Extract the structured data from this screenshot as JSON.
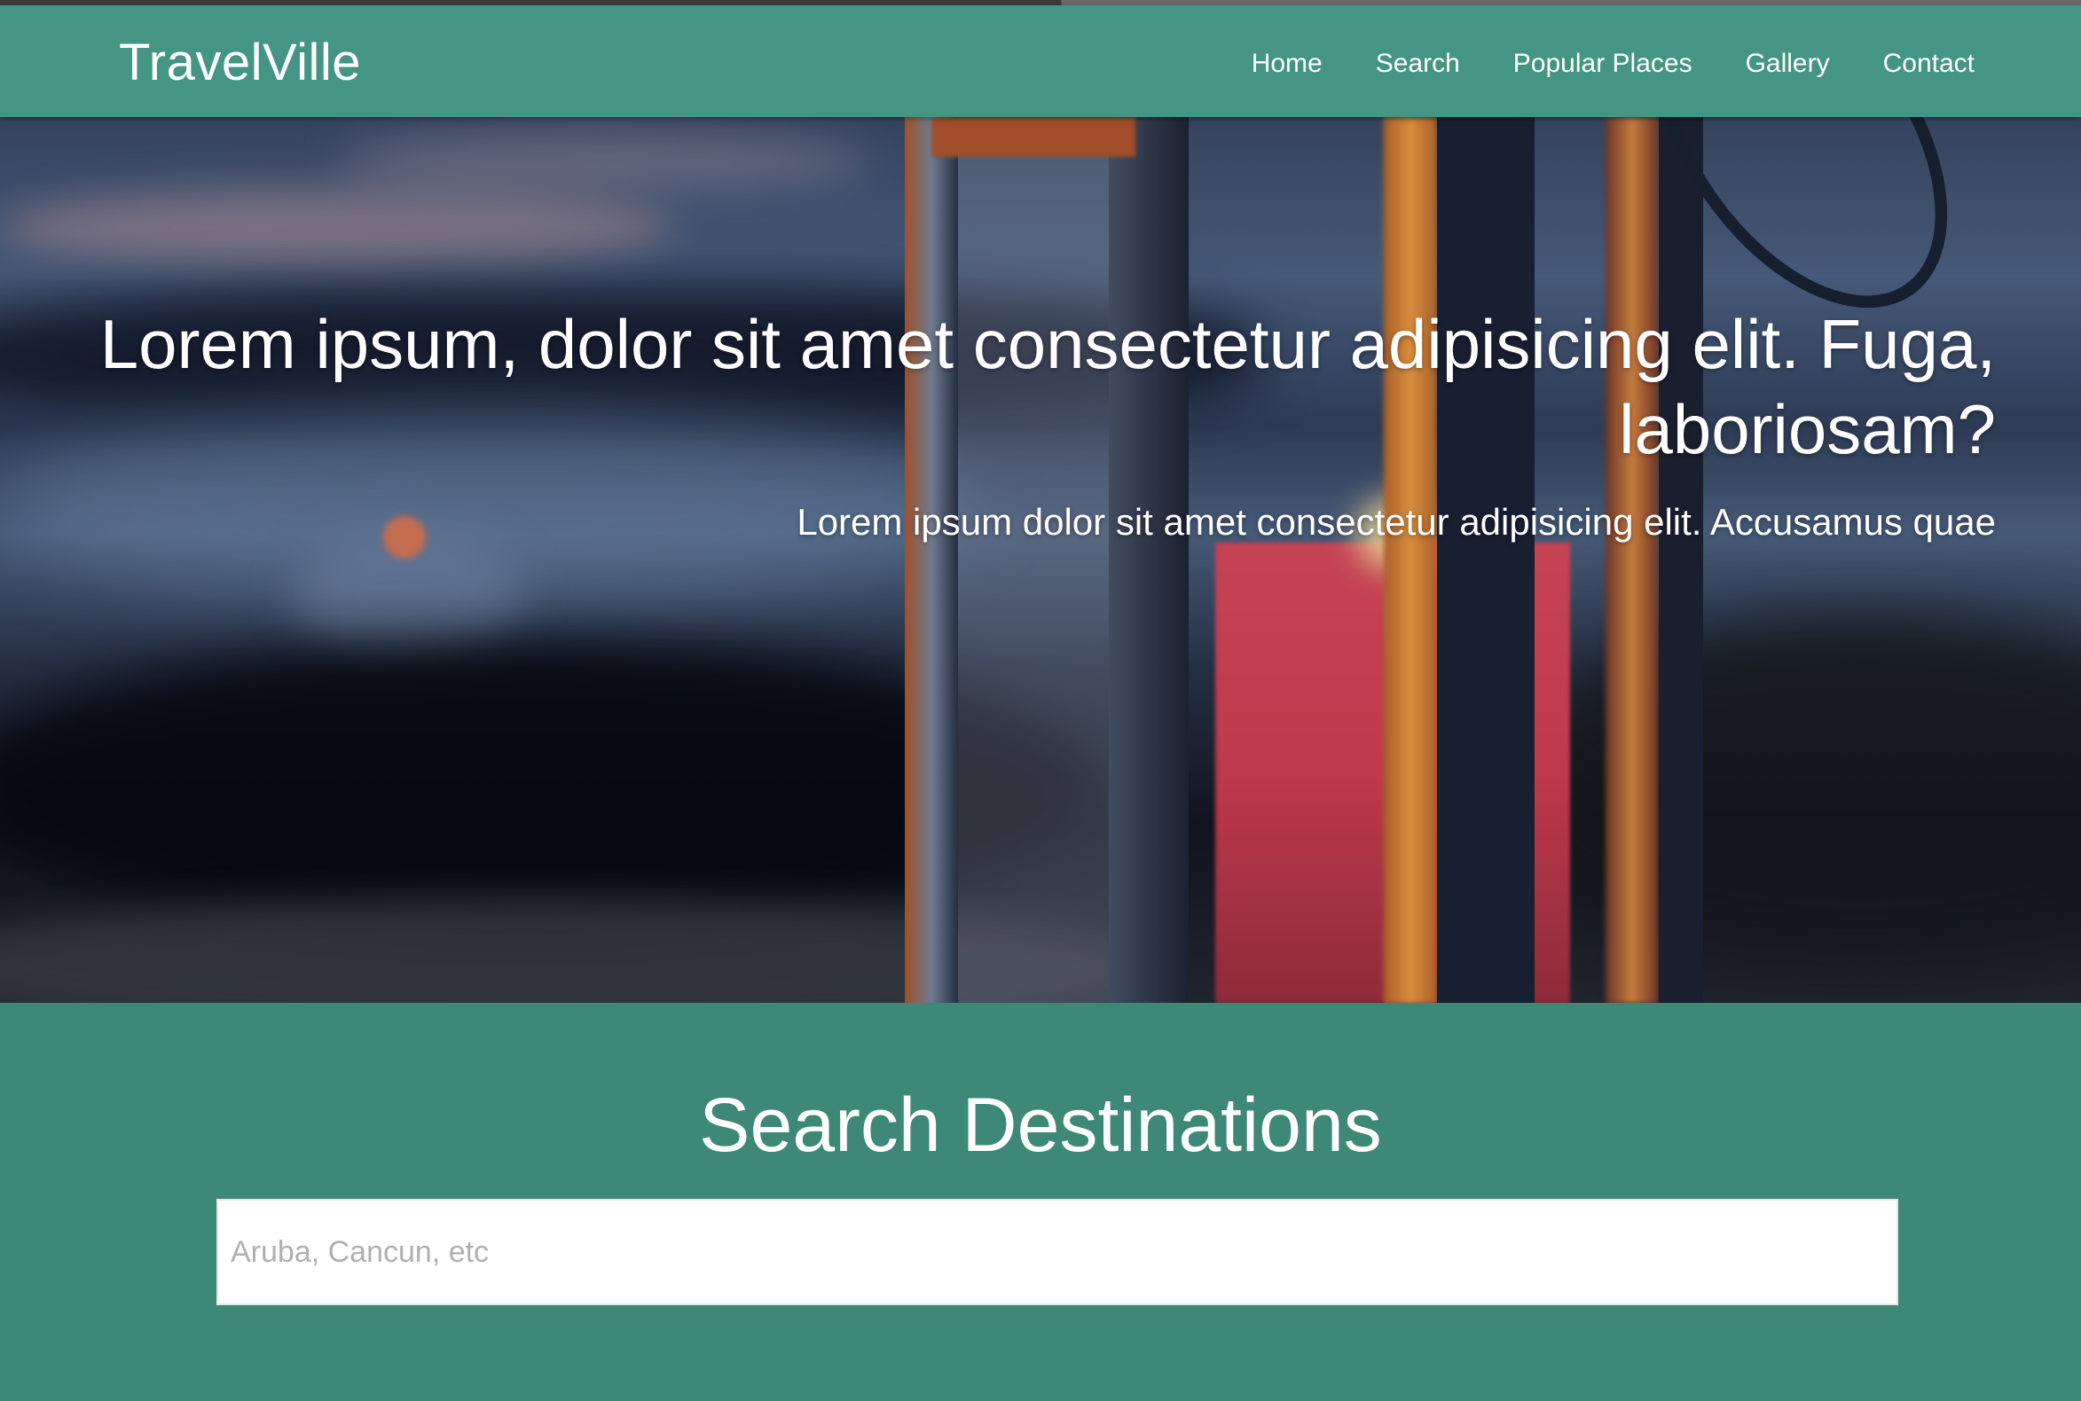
{
  "header": {
    "brand": "TravelVille",
    "nav": [
      {
        "label": "Home"
      },
      {
        "label": "Search"
      },
      {
        "label": "Popular Places"
      },
      {
        "label": "Gallery"
      },
      {
        "label": "Contact"
      }
    ]
  },
  "hero": {
    "title": "Lorem ipsum, dolor sit amet consectetur adipisicing elit. Fuga, laboriosam?",
    "subtitle": "Lorem ipsum dolor sit amet consectetur adipisicing elit. Accusamus quae"
  },
  "search": {
    "title": "Search Destinations",
    "placeholder": "Aruba, Cancun, etc",
    "value": ""
  },
  "colors": {
    "navbar": "#459584",
    "section": "#3e8878",
    "text": "#ffffff"
  }
}
